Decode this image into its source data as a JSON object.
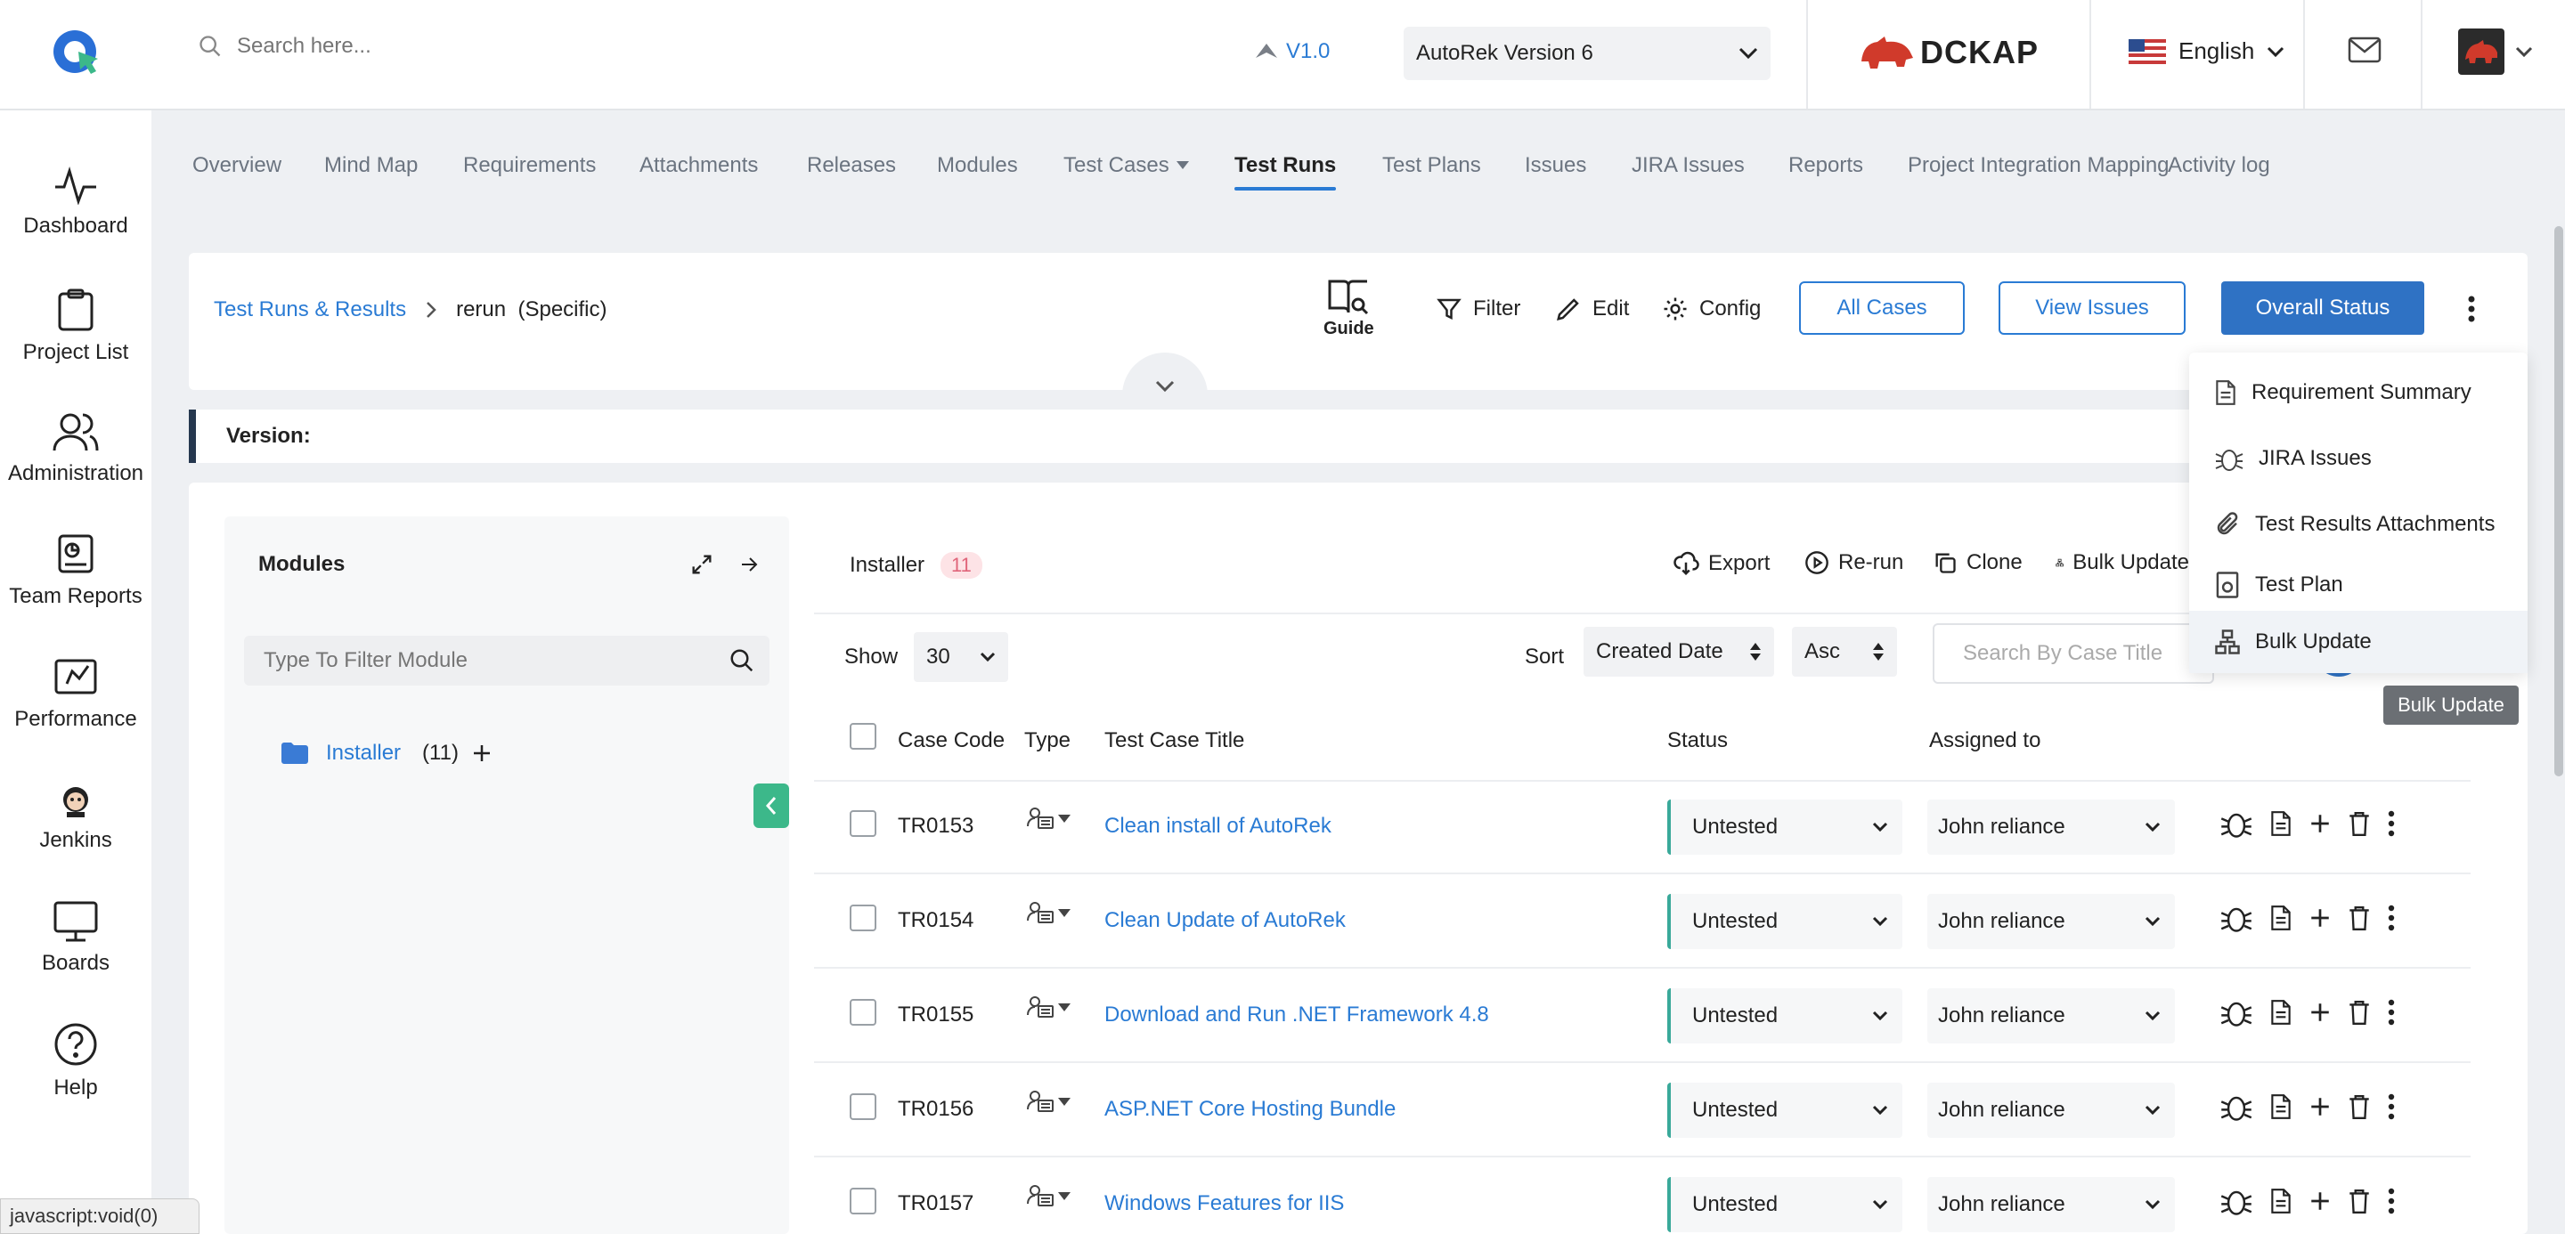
{
  "app": {
    "search_placeholder": "Search here...",
    "version": "V1.0",
    "project_version": "AutoRek Version 6",
    "brand": "DCKAP",
    "language": "English"
  },
  "sidebar": [
    {
      "label": "Dashboard",
      "icon": "pulse-icon"
    },
    {
      "label": "Project List",
      "icon": "clipboard-icon"
    },
    {
      "label": "Administration",
      "icon": "users-icon"
    },
    {
      "label": "Team Reports",
      "icon": "report-icon"
    },
    {
      "label": "Performance",
      "icon": "rocket-icon"
    },
    {
      "label": "Jenkins",
      "icon": "jenkins-icon"
    },
    {
      "label": "Boards",
      "icon": "monitor-icon"
    },
    {
      "label": "Help",
      "icon": "help-icon"
    }
  ],
  "tabs": [
    "Overview",
    "Mind Map",
    "Requirements",
    "Attachments",
    "Releases",
    "Modules",
    "Test Cases",
    "Test Runs",
    "Test Plans",
    "Issues",
    "JIRA Issues",
    "Reports",
    "Project Integration Mapping",
    "Activity log"
  ],
  "active_tab": "Test Runs",
  "breadcrumb": {
    "root": "Test Runs & Results",
    "current": "rerun",
    "qualifier": "(Specific)"
  },
  "toolbar": {
    "guide": "Guide",
    "filter": "Filter",
    "edit": "Edit",
    "config": "Config",
    "all_cases": "All Cases",
    "view_issues": "View Issues",
    "overall_status": "Overall Status"
  },
  "version_label": "Version:",
  "modules": {
    "title": "Modules",
    "filter_placeholder": "Type To Filter Module",
    "item_name": "Installer",
    "item_count": "(11)"
  },
  "table_panel": {
    "module": "Installer",
    "count": "11",
    "actions": {
      "export": "Export",
      "rerun": "Re-run",
      "clone": "Clone",
      "bulk": "Bulk Update"
    },
    "show_label": "Show",
    "show_value": "30",
    "sort_label": "Sort",
    "sort_field": "Created Date",
    "sort_dir": "Asc",
    "search_placeholder": "Search By Case Title",
    "headers": {
      "code": "Case Code",
      "type": "Type",
      "title": "Test Case Title",
      "status": "Status",
      "assigned": "Assigned to"
    },
    "rows": [
      {
        "code": "TR0153",
        "title": "Clean install of AutoRek",
        "status": "Untested",
        "assigned": "John reliance"
      },
      {
        "code": "TR0154",
        "title": "Clean Update of AutoRek",
        "status": "Untested",
        "assigned": "John reliance"
      },
      {
        "code": "TR0155",
        "title": "Download and Run .NET Framework 4.8",
        "status": "Untested",
        "assigned": "John reliance"
      },
      {
        "code": "TR0156",
        "title": "ASP.NET Core Hosting Bundle",
        "status": "Untested",
        "assigned": "John reliance"
      },
      {
        "code": "TR0157",
        "title": "Windows Features for IIS",
        "status": "Untested",
        "assigned": "John reliance"
      }
    ]
  },
  "menu": [
    "Requirement Summary",
    "JIRA Issues",
    "Test Results Attachments",
    "Test Plan",
    "Bulk Update"
  ],
  "tooltip": "Bulk Update",
  "status_bar": "javascript:void(0)"
}
